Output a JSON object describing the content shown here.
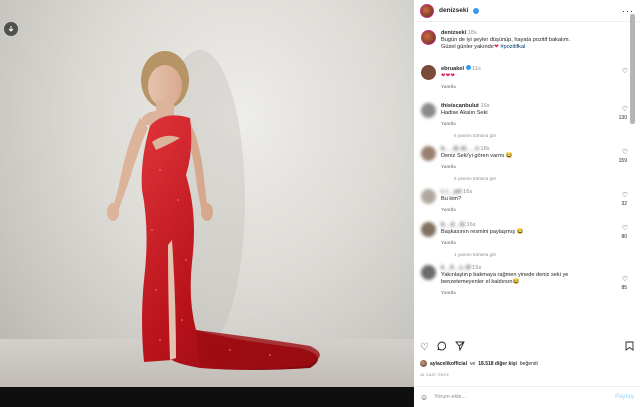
{
  "post": {
    "author": "denizseki",
    "caption_author": "denizseki",
    "caption_time": "18s",
    "caption_text": "Bugün de iyi şeyler düşünüp, hayata pozitif bakalım.",
    "caption_text2": "Güzel günler yakındır",
    "caption_hashtag": "#pozitifkal",
    "likes_user": "aylacelikofficial",
    "likes_connector": "ve",
    "likes_count": "18.518 diğer kişi",
    "likes_suffix": "beğendi",
    "timestamp": "18 SAAT ÖNCE"
  },
  "comments": [
    {
      "user": "ebruakel",
      "time": "11s",
      "text": "❤❤❤",
      "reply": "Yanıtla",
      "likes": "",
      "avatar_color": "#7a4a3a"
    },
    {
      "user": "thisiscanbulut",
      "time": "16s",
      "text": "Hadise Akalın Seki",
      "reply": "Yanıtla",
      "likes": "130",
      "avatar_color": "#8a8a8a"
    },
    {
      "user": "b___ki_ki___n",
      "time": "18s",
      "text": "Deniz Seki'yi gören varmı 😂",
      "reply": "Yanıtla",
      "likes": "159",
      "avatar_color": "#9a8070"
    },
    {
      "user": "t_i__yel",
      "time": "16s",
      "text": "Bu kim?",
      "reply": "Yanıtla",
      "likes": "32",
      "avatar_color": "#b0a8a0"
    },
    {
      "user": "b__d__ki",
      "time": "16s",
      "text": "Başkasının resmini paylaşmış 😂",
      "reply": "Yanıtla",
      "likes": "80",
      "avatar_color": "#807060"
    },
    {
      "user": "k__ll__c_ill",
      "time": "15s",
      "text": "Yakınlaştırıp bakmaya rağmen yinede deniz seki ye benzetemeyenler el kaldırsın😂",
      "reply": "Yanıtla",
      "likes": "85",
      "avatar_color": "#6a6a6a"
    }
  ],
  "view_replies": [
    "6 yanıtın tümünü gör",
    "5 yanıtın tümünü gör",
    "1 yanıtın tümünü gör"
  ],
  "add_comment": {
    "placeholder": "Yorum ekle...",
    "post_label": "Paylaş"
  },
  "colors": {
    "dress": "#c0161c",
    "link": "#00376b",
    "post_button": "#b2dffc"
  },
  "icons": [
    "download-icon",
    "more-icon",
    "heart-icon",
    "comment-icon",
    "share-icon",
    "bookmark-icon",
    "emoji-icon"
  ]
}
